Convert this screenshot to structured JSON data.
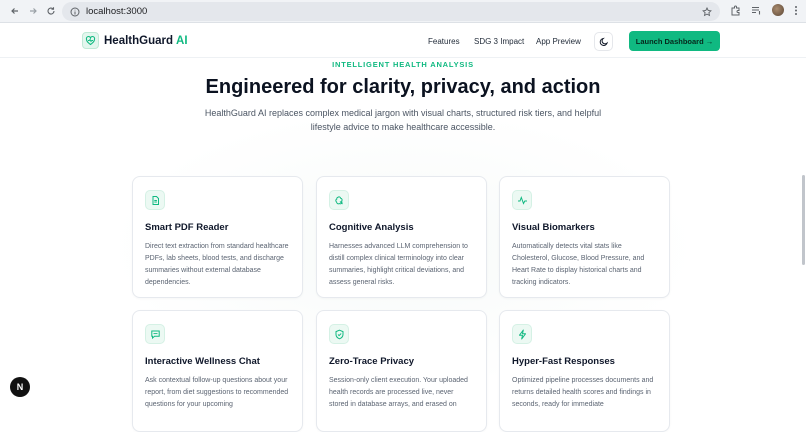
{
  "browser": {
    "url": "localhost:3000"
  },
  "nav": {
    "brand_name": "HealthGuard",
    "brand_ai": "AI",
    "links": [
      "Features",
      "SDG 3 Impact",
      "App Preview"
    ],
    "cta_label": "Launch Dashboard →"
  },
  "hero": {
    "eyebrow": "INTELLIGENT HEALTH ANALYSIS",
    "title": "Engineered for clarity, privacy, and action",
    "subtitle": "HealthGuard AI replaces complex medical jargon with visual charts, structured risk tiers, and helpful lifestyle advice to make healthcare accessible."
  },
  "features": [
    {
      "icon": "document-icon",
      "title": "Smart PDF Reader",
      "desc": "Direct text extraction from standard healthcare PDFs, lab sheets, blood tests, and discharge summaries without external database dependencies."
    },
    {
      "icon": "brain-icon",
      "title": "Cognitive Analysis",
      "desc": "Harnesses advanced LLM comprehension to distill complex clinical terminology into clear summaries, highlight critical deviations, and assess general risks."
    },
    {
      "icon": "activity-icon",
      "title": "Visual Biomarkers",
      "desc": "Automatically detects vital stats like Cholesterol, Glucose, Blood Pressure, and Heart Rate to display historical charts and tracking indicators."
    },
    {
      "icon": "chat-icon",
      "title": "Interactive Wellness Chat",
      "desc": "Ask contextual follow-up questions about your report, from diet suggestions to recommended questions for your upcoming"
    },
    {
      "icon": "shield-icon",
      "title": "Zero-Trace Privacy",
      "desc": "Session-only client execution. Your uploaded health records are processed live, never stored in database arrays, and erased on"
    },
    {
      "icon": "lightning-icon",
      "title": "Hyper-Fast Responses",
      "desc": "Optimized pipeline processes documents and returns detailed health scores and findings in seconds, ready for immediate"
    }
  ],
  "dev_badge": "N"
}
